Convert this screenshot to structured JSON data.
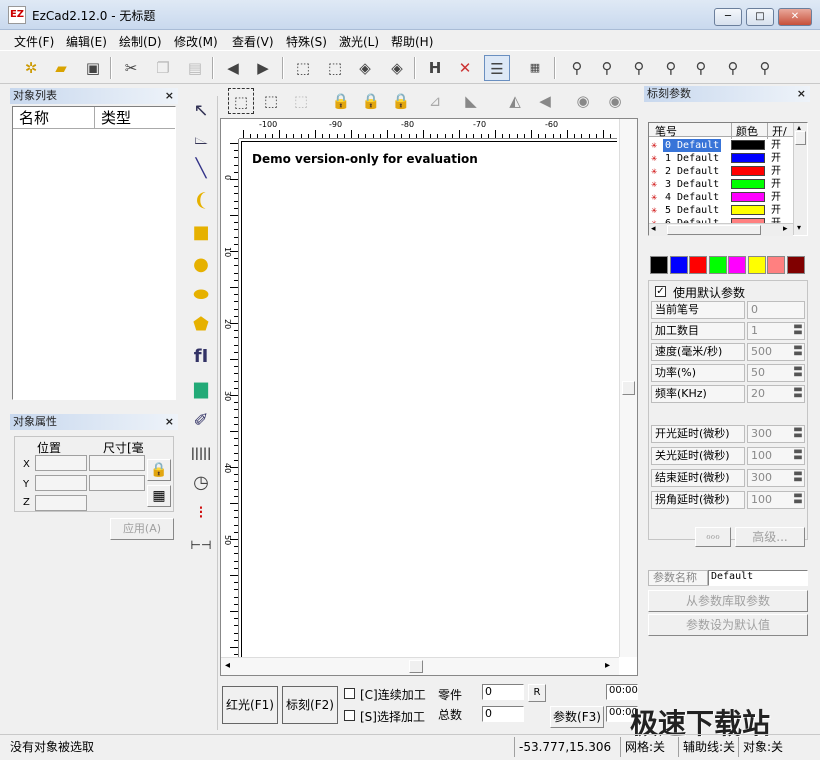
{
  "window": {
    "app_icon_text": "EZ",
    "title": "EzCad2.12.0 - 无标题",
    "min": "─",
    "max": "□",
    "close": "✕"
  },
  "menu": [
    "文件(F)",
    "编辑(E)",
    "绘制(D)",
    "修改(M)",
    "查看(V)",
    "特殊(S)",
    "激光(L)",
    "帮助(H)"
  ],
  "toolbar_icons": [
    "new-icon",
    "open-icon",
    "save-icon",
    "cut-icon",
    "copy-icon",
    "paste-icon",
    "back-icon",
    "forward-icon",
    "select-nodes-icon",
    "node-edit-icon",
    "node-add-icon",
    "node-remove-icon",
    "h-tool-icon",
    "tools-icon",
    "object-list-icon",
    "barcode-icon",
    "zoom-icon",
    "zoom-in-icon",
    "zoom-plus-icon",
    "zoom-minus-icon",
    "zoom-fit-icon",
    "zoom-all-icon",
    "zoom-page-icon"
  ],
  "object_list": {
    "title": "对象列表",
    "close": "×",
    "col_name": "名称",
    "col_type": "类型"
  },
  "object_props": {
    "title": "对象属性",
    "close": "×",
    "pos_label": "位置",
    "size_label": "尺寸[毫",
    "x": "X",
    "y": "Y",
    "z": "Z",
    "apply": "应用(A)"
  },
  "canvas": {
    "watermark_text": "Demo version-only for evaluation",
    "ruler_h": [
      "-100",
      "-90",
      "-80",
      "-70",
      "-60"
    ],
    "ruler_v": [
      "0",
      "10",
      "20",
      "30",
      "40",
      "50"
    ]
  },
  "bottom": {
    "red_light": "红光(F1)",
    "mark": "标刻(F2)",
    "continuous": "[C]连续加工",
    "select_mark": "[S]选择加工",
    "parts_label": "零件",
    "parts_value": "0",
    "reset": "R",
    "total_label": "总数",
    "total_value": "0",
    "params": "参数(F3)",
    "time1": "00:00",
    "time2": "00:00"
  },
  "mark_params": {
    "title": "标刻参数",
    "close": "×",
    "col_pen": "笔号",
    "col_color": "颜色",
    "col_onoff": "开/",
    "pens": [
      {
        "num": "0",
        "name": "Default",
        "color": "#000000",
        "on": "开",
        "selected": true
      },
      {
        "num": "1",
        "name": "Default",
        "color": "#0000ff",
        "on": "开"
      },
      {
        "num": "2",
        "name": "Default",
        "color": "#ff0000",
        "on": "开"
      },
      {
        "num": "3",
        "name": "Default",
        "color": "#00ff00",
        "on": "开"
      },
      {
        "num": "4",
        "name": "Default",
        "color": "#ff00ff",
        "on": "开"
      },
      {
        "num": "5",
        "name": "Default",
        "color": "#ffff00",
        "on": "开"
      },
      {
        "num": "6",
        "name": "Default",
        "color": "#ff8080",
        "on": "开"
      }
    ],
    "palette": [
      "#000000",
      "#0000ff",
      "#ff0000",
      "#00ff00",
      "#ff00ff",
      "#ffff00",
      "#ff8080",
      "#800000"
    ],
    "use_default": "使用默认参数",
    "rows": [
      {
        "label": "当前笔号",
        "value": "0"
      },
      {
        "label": "加工数目",
        "value": "1"
      },
      {
        "label": "速度(毫米/秒)",
        "value": "500"
      },
      {
        "label": "功率(%)",
        "value": "50"
      },
      {
        "label": "频率(KHz)",
        "value": "20"
      }
    ],
    "delays": [
      {
        "label": "开光延时(微秒)",
        "value": "300"
      },
      {
        "label": "关光延时(微秒)",
        "value": "100"
      },
      {
        "label": "结束延时(微秒)",
        "value": "300"
      },
      {
        "label": "拐角延时(微秒)",
        "value": "100"
      }
    ],
    "wobble_icon": "ℴℴℴ",
    "advanced": "高级...",
    "param_name_label": "参数名称",
    "param_name_value": "Default",
    "from_lib": "从参数库取参数",
    "set_default": "参数设为默认值"
  },
  "status": {
    "message": "没有对象被选取",
    "coords": "-53.777,15.306",
    "grid": "网格:关",
    "guide": "辅助线:关",
    "object": "对象:关"
  },
  "watermark_logo": "极速下载站"
}
